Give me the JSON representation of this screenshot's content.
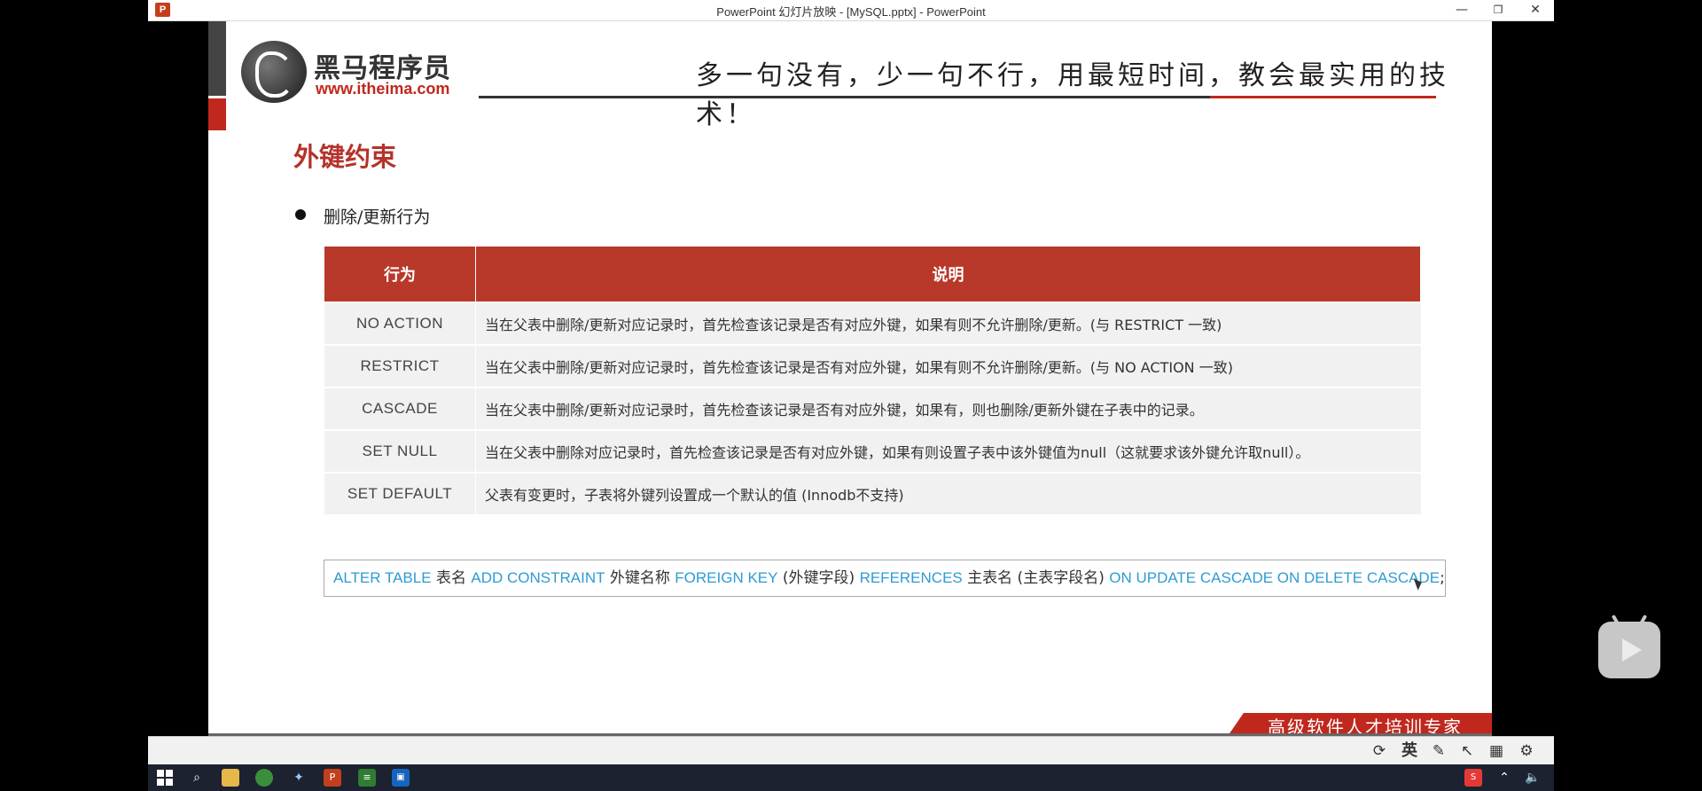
{
  "window": {
    "title": "PowerPoint 幻灯片放映 - [MySQL.pptx] - PowerPoint",
    "app_icon": "P",
    "controls": [
      "—",
      "❐",
      "✕"
    ]
  },
  "slide": {
    "brand": {
      "name": "黑马程序员",
      "url": "www.itheima.com"
    },
    "slogan": "多一句没有，少一句不行，用最短时间，教会最实用的技术！",
    "title": "外键约束",
    "bullet": "删除/更新行为",
    "table": {
      "headers": [
        "行为",
        "说明"
      ],
      "rows": [
        {
          "action": "NO ACTION",
          "desc": "当在父表中删除/更新对应记录时，首先检查该记录是否有对应外键，如果有则不允许删除/更新。(与 RESTRICT 一致)"
        },
        {
          "action": "RESTRICT",
          "desc": "当在父表中删除/更新对应记录时，首先检查该记录是否有对应外键，如果有则不允许删除/更新。(与 NO ACTION 一致)"
        },
        {
          "action": "CASCADE",
          "desc": "当在父表中删除/更新对应记录时，首先检查该记录是否有对应外键，如果有，则也删除/更新外键在子表中的记录。"
        },
        {
          "action": "SET NULL",
          "desc": "当在父表中删除对应记录时，首先检查该记录是否有对应外键，如果有则设置子表中该外键值为null（这就要求该外键允许取null）。"
        },
        {
          "action": "SET DEFAULT",
          "desc": "父表有变更时，子表将外键列设置成一个默认的值 (Innodb不支持)"
        }
      ]
    },
    "sql": {
      "kw1": "ALTER TABLE",
      "t1": " 表名 ",
      "kw2": "ADD CONSTRAINT",
      "t2": " 外键名称 ",
      "kw3": "FOREIGN KEY",
      "t3": " (外键字段) ",
      "kw4": "REFERENCES",
      "t4": " 主表名 (主表字段名) ",
      "kw5": "ON UPDATE CASCADE ON DELETE CASCADE",
      "t5": ";"
    },
    "footer_slogan": "高级软件人才培训专家"
  },
  "toolbar": {
    "ime": "英"
  },
  "colors": {
    "accent_red": "#c0281e",
    "table_header": "#b8382a",
    "sql_keyword": "#2e9bd3"
  }
}
